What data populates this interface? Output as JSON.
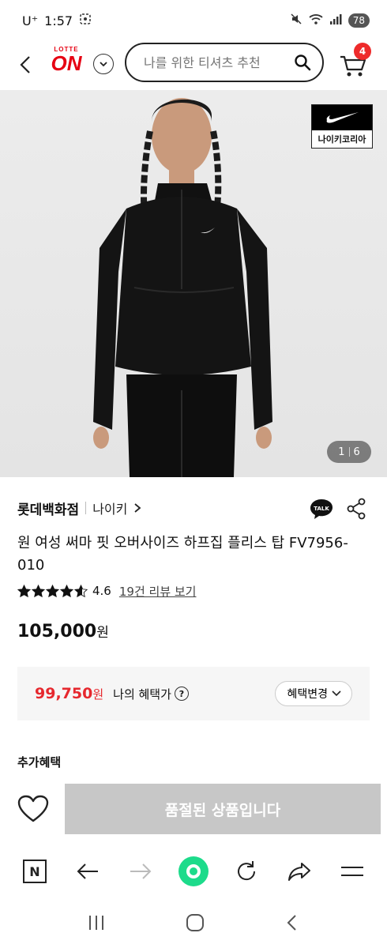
{
  "status_bar": {
    "carrier": "U⁺",
    "time": "1:57",
    "battery": "78"
  },
  "header": {
    "logo_top": "LOTTE",
    "logo_main": "ON",
    "search_placeholder": "나를 위한 티셔츠 추천",
    "cart_count": "4"
  },
  "gallery": {
    "brand_badge": "나이키코리아",
    "current": "1",
    "total": "6"
  },
  "product": {
    "store": "롯데백화점",
    "brand": "나이키",
    "talk_label": "TALK",
    "title": "원 여성 써마 핏 오버사이즈 하프집 플리스 탑 FV7956-010",
    "rating": "4.6",
    "rating_value": 4.6,
    "review_link": "19건 리뷰 보기",
    "price": "105,000",
    "currency": "원"
  },
  "benefit": {
    "price": "99,750",
    "currency": "원",
    "label": "나의 혜택가",
    "help": "?",
    "change_button": "혜택변경"
  },
  "extra_benefit_title": "추가혜택",
  "purchase": {
    "soldout_label": "품절된 상품입니다"
  },
  "browser": {
    "n_label": "N"
  },
  "colors": {
    "brand_red": "#e60012",
    "benefit_red": "#e6282e",
    "soldout_gray": "#c7c7c7",
    "browser_green": "#1ddb8b"
  }
}
